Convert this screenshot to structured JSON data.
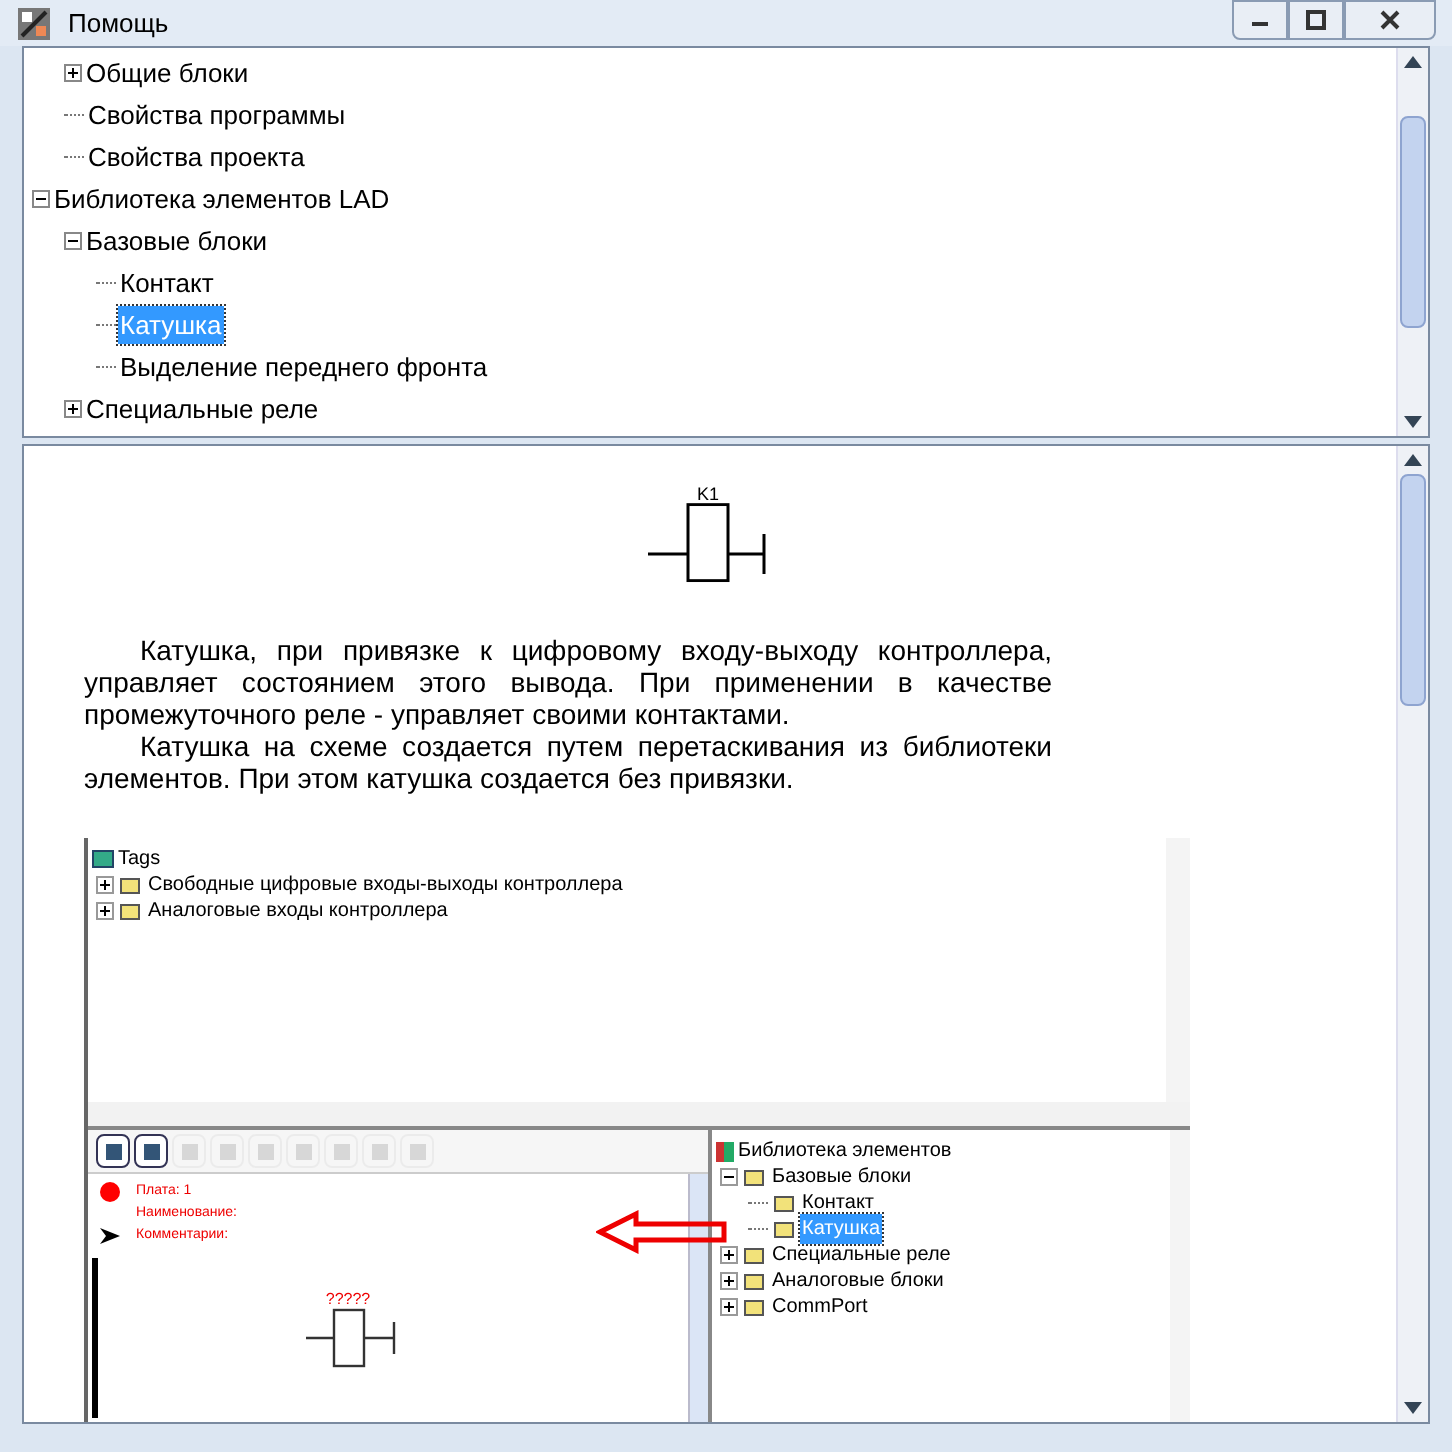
{
  "window": {
    "title": "Помощь"
  },
  "tree": {
    "partial_branch": [
      {
        "label": "Общие блоки",
        "expanded": false,
        "selected": false
      },
      {
        "label": "Свойства программы",
        "selected": false
      },
      {
        "label": "Свойства проекта",
        "selected": false
      }
    ],
    "items": [
      {
        "label": "Библиотека элементов LAD",
        "expanded": true,
        "selected": false,
        "children": [
          {
            "label": "Базовые блоки",
            "expanded": true,
            "selected": false,
            "children": [
              {
                "label": "Контакт",
                "selected": false
              },
              {
                "label": "Катушка",
                "selected": true
              },
              {
                "label": "Выделение переднего фронта",
                "selected": false
              }
            ]
          },
          {
            "label": "Специальные реле",
            "expanded": false,
            "selected": false
          }
        ]
      }
    ]
  },
  "article": {
    "symbol_label": "K1",
    "paragraphs": [
      "Катушка, при привязке к цифровому входу-выходу контроллера, управляет состоянием этого вывода. При применении в качестве промежуточного реле - управляет своими контактами.",
      "Катушка на схеме создается путем перетаскивания из библиотеки элементов. При этом катушка создается без привязки."
    ],
    "screenshot": {
      "tags": {
        "root": "Tags",
        "items": [
          {
            "label": "Свободные цифровые входы-выходы контроллера",
            "expanded": false
          },
          {
            "label": "Аналоговые входы контроллера",
            "expanded": false
          }
        ]
      },
      "toolbar": [
        {
          "disabled": false
        },
        {
          "disabled": false
        },
        {
          "disabled": true
        },
        {
          "disabled": true
        },
        {
          "disabled": true
        },
        {
          "disabled": true
        },
        {
          "disabled": true
        },
        {
          "disabled": true
        },
        {
          "disabled": true
        }
      ],
      "info": [
        "Плата: 1",
        "Наименование:",
        "Комментарии:"
      ],
      "coil_label": "?????",
      "library": {
        "root": "Библиотека элементов",
        "items": [
          {
            "label": "Базовые блоки",
            "expanded": true,
            "selected": false,
            "children": [
              {
                "label": "Контакт",
                "selected": false
              },
              {
                "label": "Катушка",
                "selected": true
              }
            ]
          },
          {
            "label": "Специальные реле",
            "expanded": false,
            "selected": false
          },
          {
            "label": "Аналоговые блоки",
            "expanded": false,
            "selected": false
          },
          {
            "label": "CommPort",
            "expanded": false,
            "selected": false
          }
        ]
      }
    }
  }
}
